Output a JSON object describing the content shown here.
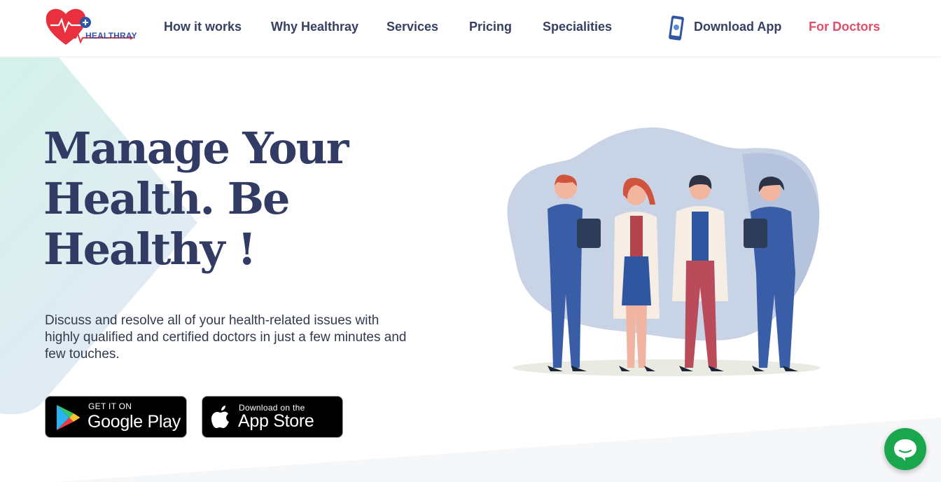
{
  "brand": {
    "name": "HEALTHRAY",
    "colors": {
      "primary_text": "#313b63",
      "accent": "#e14f67",
      "logo_blue": "#2f55a4",
      "chat_green": "#19a64d"
    }
  },
  "nav": {
    "items": [
      {
        "label": "How it works"
      },
      {
        "label": "Why Healthray"
      },
      {
        "label": "Services"
      },
      {
        "label": "Pricing"
      },
      {
        "label": "Specialities"
      },
      {
        "label": "Download App",
        "icon": "phone-icon"
      },
      {
        "label": "For Doctors"
      }
    ]
  },
  "hero": {
    "title": "Manage Your Health. Be Healthy !",
    "description": "Discuss and resolve all of your health-related issues with highly qualified and certified doctors in just a few minutes and few touches."
  },
  "stores": {
    "google": {
      "small": "GET IT ON",
      "big": "Google Play",
      "icon": "google-play-icon"
    },
    "apple": {
      "small": "Download on the",
      "big": "App Store",
      "icon": "apple-icon"
    }
  },
  "chat": {
    "icon": "chat-bubble-icon"
  }
}
